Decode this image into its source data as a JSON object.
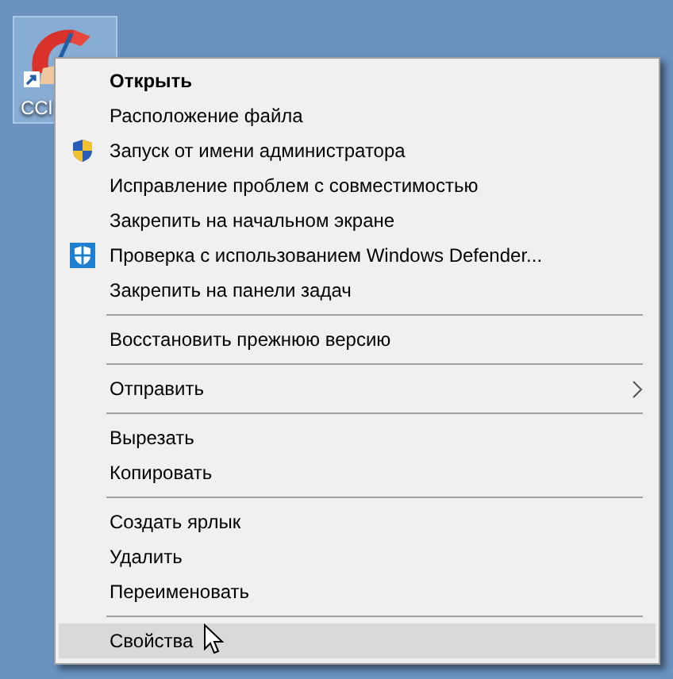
{
  "desktop_icon": {
    "label": "CCl",
    "selected": true
  },
  "menu": {
    "items": [
      {
        "kind": "item",
        "label": "Открыть",
        "bold": true,
        "selected": false
      },
      {
        "kind": "item",
        "label": "Расположение файла",
        "bold": false,
        "selected": false
      },
      {
        "kind": "shield",
        "label": "Запуск от имени администратора",
        "bold": false,
        "selected": false
      },
      {
        "kind": "item",
        "label": "Исправление проблем с совместимостью",
        "bold": false,
        "selected": false
      },
      {
        "kind": "item",
        "label": "Закрепить на начальном экране",
        "bold": false,
        "selected": false
      },
      {
        "kind": "defender",
        "label": "Проверка с использованием Windows Defender...",
        "bold": false,
        "selected": false
      },
      {
        "kind": "item",
        "label": "Закрепить на панели задач",
        "bold": false,
        "selected": false
      },
      {
        "kind": "separator"
      },
      {
        "kind": "item",
        "label": "Восстановить прежнюю версию",
        "bold": false,
        "selected": false
      },
      {
        "kind": "separator"
      },
      {
        "kind": "submenu",
        "label": "Отправить",
        "bold": false,
        "selected": false
      },
      {
        "kind": "separator"
      },
      {
        "kind": "item",
        "label": "Вырезать",
        "bold": false,
        "selected": false
      },
      {
        "kind": "item",
        "label": "Копировать",
        "bold": false,
        "selected": false
      },
      {
        "kind": "separator"
      },
      {
        "kind": "item",
        "label": "Создать ярлык",
        "bold": false,
        "selected": false
      },
      {
        "kind": "item",
        "label": "Удалить",
        "bold": false,
        "selected": false
      },
      {
        "kind": "item",
        "label": "Переименовать",
        "bold": false,
        "selected": false
      },
      {
        "kind": "separator"
      },
      {
        "kind": "item",
        "label": "Свойства",
        "bold": false,
        "selected": true
      }
    ]
  }
}
